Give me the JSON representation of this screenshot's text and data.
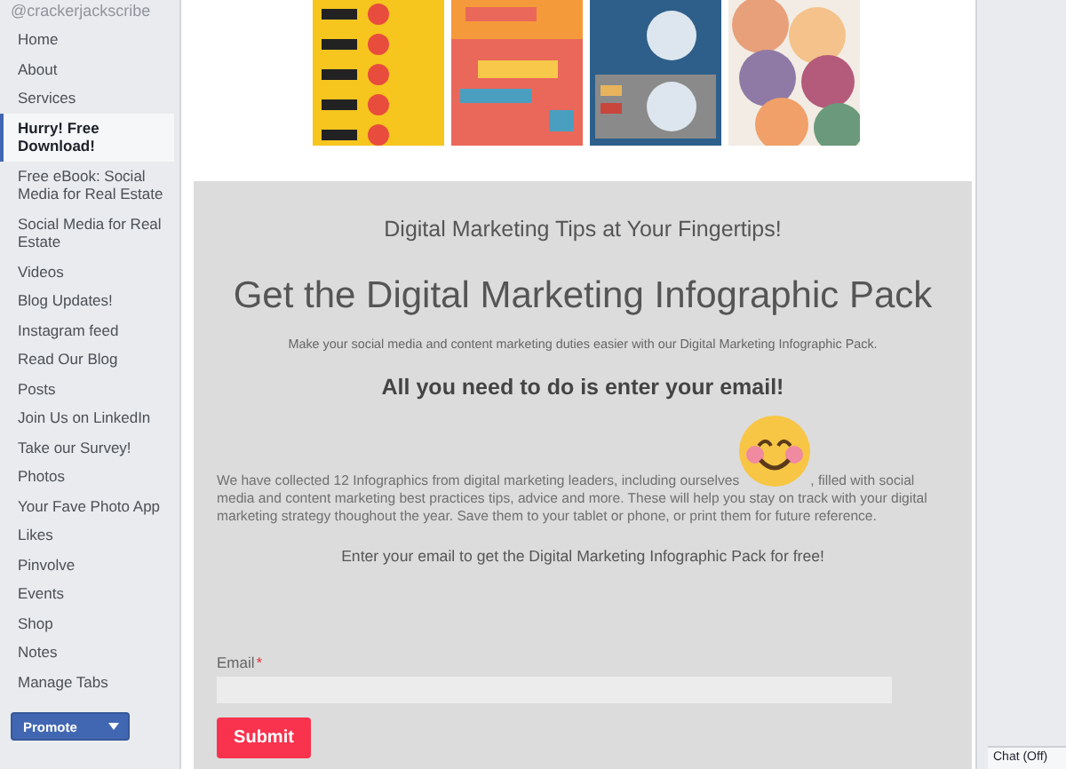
{
  "page_handle": "@crackerjackscribe",
  "sidebar": {
    "items": [
      {
        "label": "Home",
        "selected": false
      },
      {
        "label": "About",
        "selected": false
      },
      {
        "label": "Services",
        "selected": false
      },
      {
        "label": "Hurry! Free Download!",
        "selected": true
      },
      {
        "label": "Free eBook: Social Media for Real Estate",
        "selected": false
      },
      {
        "label": "Social Media for Real Estate",
        "selected": false
      },
      {
        "label": "Videos",
        "selected": false
      },
      {
        "label": "Blog Updates!",
        "selected": false
      },
      {
        "label": "Instagram feed",
        "selected": false
      },
      {
        "label": "Read Our Blog",
        "selected": false
      },
      {
        "label": "Posts",
        "selected": false
      },
      {
        "label": "Join Us on LinkedIn",
        "selected": false
      },
      {
        "label": "Take our Survey!",
        "selected": false
      },
      {
        "label": "Photos",
        "selected": false
      },
      {
        "label": "Your Fave Photo App",
        "selected": false
      },
      {
        "label": "Likes",
        "selected": false
      },
      {
        "label": "Pinvolve",
        "selected": false
      },
      {
        "label": "Events",
        "selected": false
      },
      {
        "label": "Shop",
        "selected": false
      },
      {
        "label": "Notes",
        "selected": false
      },
      {
        "label": "Manage Tabs",
        "selected": false
      }
    ],
    "promote_button": "Promote"
  },
  "signup": {
    "tagline": "Digital Marketing Tips at Your Fingertips!",
    "heading": "Get the Digital Marketing Infographic Pack",
    "subheading": "Make your social media and content marketing duties easier with our Digital Marketing Infographic Pack.",
    "callout": "All you need to do is enter your email!",
    "paragraph_before": "We have collected 12 Infographics from digital marketing leaders, including ourselves",
    "paragraph_after": ", filled with social media and content marketing best practices tips, advice and more. These will help you stay on track with your digital marketing strategy thoughout the year. Save them to your tablet or phone, or print them for future reference.",
    "prompt": "Enter your email to get the Digital Marketing Infographic Pack for free!",
    "email_label": "Email",
    "required_mark": "*",
    "submit": "Submit"
  },
  "chat_status": "Chat (Off)"
}
